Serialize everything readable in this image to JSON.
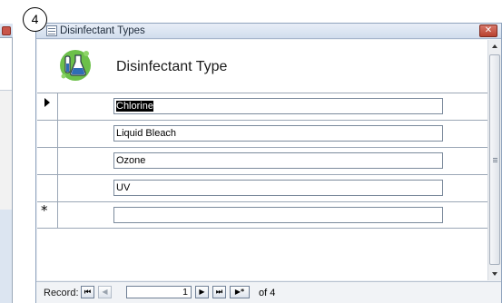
{
  "step_badge": "4",
  "window": {
    "title": "Disinfectant Types",
    "close_glyph": "✕"
  },
  "form": {
    "title": "Disinfectant Type",
    "logo_icon": "lab-flask-icon",
    "records": [
      {
        "value": "Chlorine",
        "current": true
      },
      {
        "value": "Liquid Bleach",
        "current": false
      },
      {
        "value": "Ozone",
        "current": false
      },
      {
        "value": "UV",
        "current": false
      }
    ],
    "new_record_marker": "*",
    "new_record_value": ""
  },
  "navigation": {
    "label": "Record:",
    "first_glyph": "⏮",
    "prev_glyph": "◀",
    "current": "1",
    "next_glyph": "▶",
    "last_glyph": "⏭",
    "new_glyph": "▶*",
    "of_label": "of 4"
  },
  "colors": {
    "accent_green": "#6cc04a",
    "flask_blue": "#2f6db5",
    "close_red": "#c8554a"
  }
}
